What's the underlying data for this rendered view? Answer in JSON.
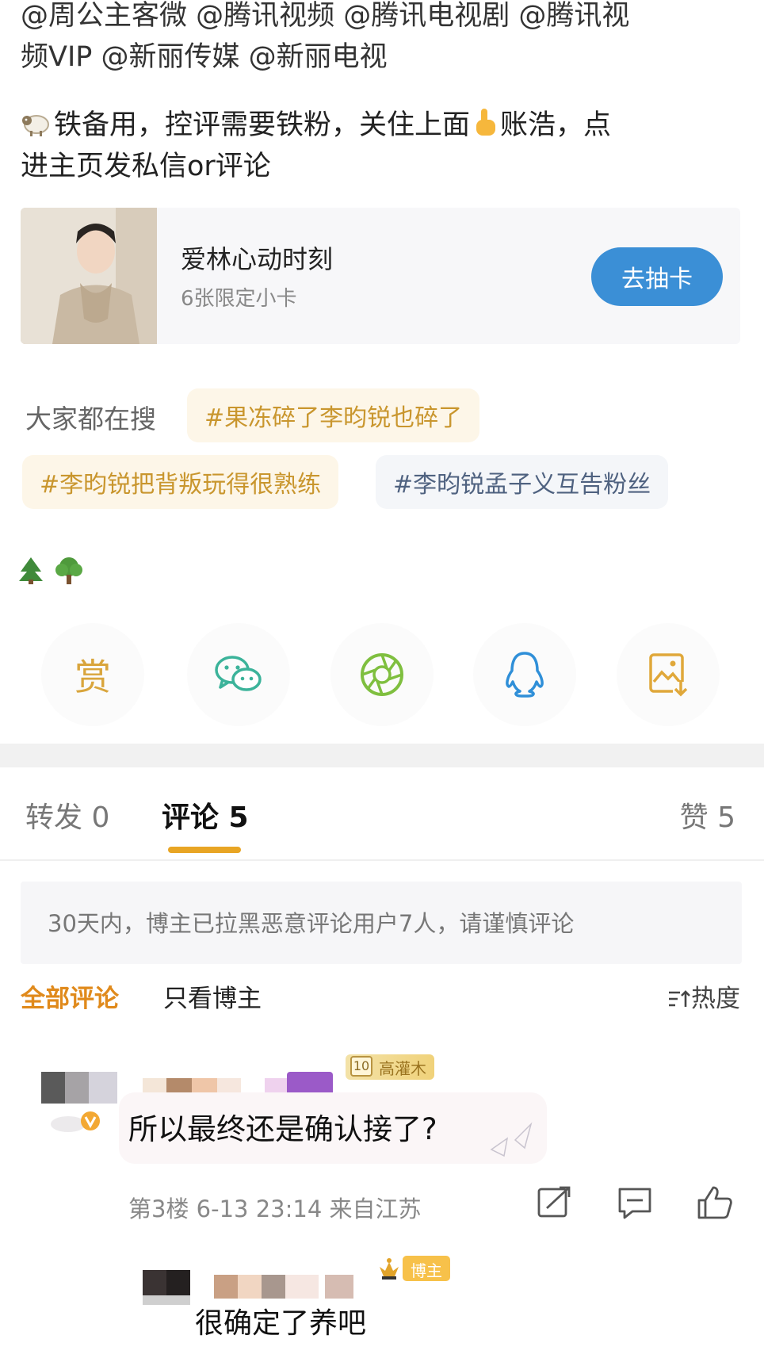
{
  "post": {
    "mentions_line1": "@周公主客微 @腾讯视频 @腾讯电视剧 @腾讯视",
    "mentions_line2": "频VIP @新丽传媒 @新丽电视",
    "note_line1": "铁备用，控评需要铁粉，关住上面",
    "note_line1_tail": "账浩，点",
    "note_line2": "进主页发私信or评论"
  },
  "card": {
    "title": "爱林心动时刻",
    "subtitle": "6张限定小卡",
    "button": "去抽卡"
  },
  "search": {
    "label": "大家都在搜",
    "chips": [
      "#果冻碎了李昀锐也碎了",
      "#李昀锐把背叛玩得很熟练",
      "#李昀锐孟子义互告粉丝"
    ]
  },
  "share": {
    "reward_label": "赏",
    "icons": [
      "reward-icon",
      "wechat-icon",
      "moments-icon",
      "qq-icon",
      "save-image-icon"
    ]
  },
  "tabs": {
    "repost": "转发 0",
    "comments": "评论 5",
    "likes": "赞 5"
  },
  "notice": "30天内，博主已拉黑恶意评论用户7人，请谨慎评论",
  "filters": {
    "all": "全部评论",
    "blogger_only": "只看博主",
    "sort": "热度"
  },
  "comments": [
    {
      "level": "10",
      "badge": "高灌木",
      "text": "所以最终还是确认接了?",
      "meta": "第3楼 6-13 23:14 来自江苏",
      "reply": {
        "badge": "博主",
        "text": "很确定了养吧"
      }
    }
  ],
  "colors": {
    "accent": "#e8a524",
    "button_blue": "#3b8fd6",
    "hot_chip_text": "#c9962e",
    "cool_chip_text": "#4f6280"
  }
}
